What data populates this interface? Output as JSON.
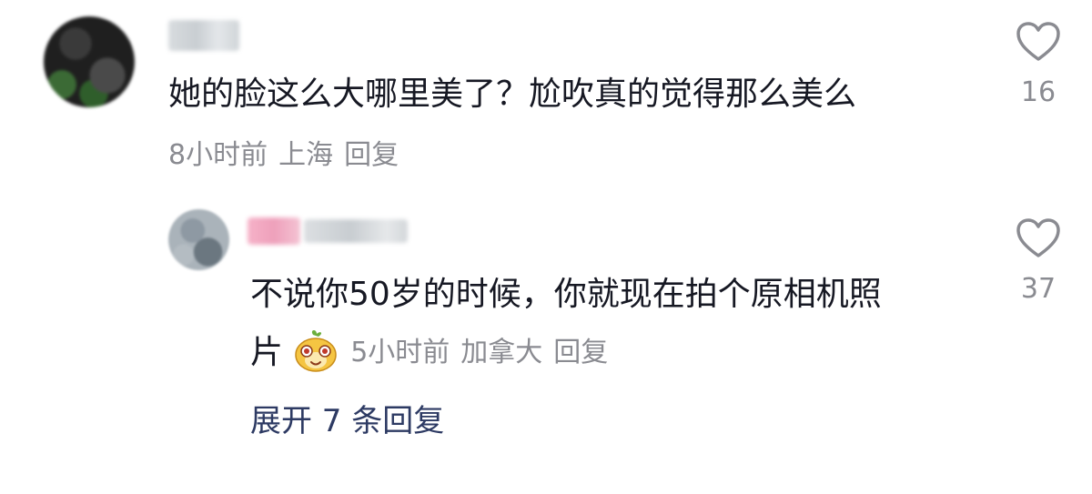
{
  "comment": {
    "text": "她的脸这么大哪里美了？尬吹真的觉得那么美么",
    "time": "8小时前",
    "location": "上海",
    "reply_label": "回复",
    "like_count": "16"
  },
  "reply": {
    "text_line1": "不说你50岁的时候，你就现在拍个原相机照",
    "text_line2": "片",
    "emoji_icon": "smiling-face-sticker-icon",
    "time": "5小时前",
    "location": "加拿大",
    "reply_label": "回复",
    "like_count": "37"
  },
  "expand_replies": {
    "label": "展开 7 条回复"
  },
  "colors": {
    "text": "#161823",
    "meta": "#8a8b91",
    "expand": "#2d3a63"
  }
}
